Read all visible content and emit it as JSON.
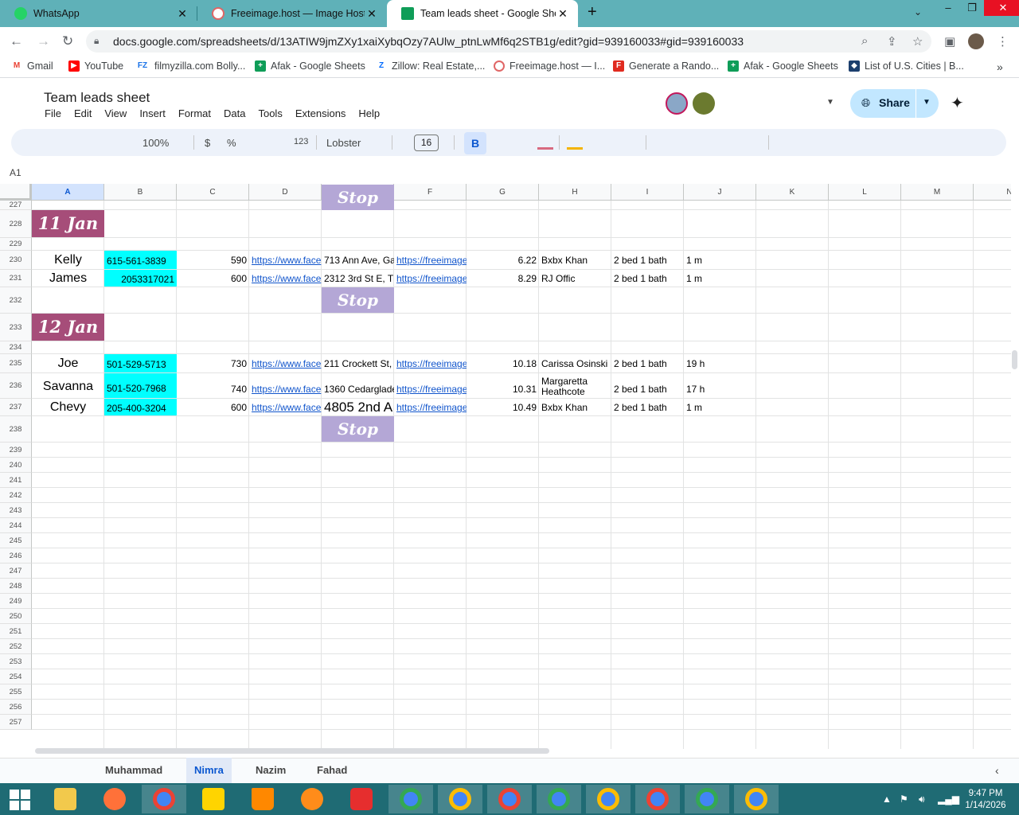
{
  "browser": {
    "tabs": [
      {
        "label": "WhatsApp",
        "icon": "whatsapp-icon",
        "color": "#25d366"
      },
      {
        "label": "Freeimage.host — Image Hosting",
        "icon": "freeimage-icon",
        "color": "#e06666"
      },
      {
        "label": "Team leads sheet - Google Sheets",
        "icon": "sheets-icon",
        "color": "#0f9d58"
      }
    ],
    "url": "docs.google.com/spreadsheets/d/13ATIW9jmZXy1xaiXybqOzy7AUlw_ptnLwMf6q2STB1g/edit?gid=939160033#gid=939160033",
    "bookmarks": [
      {
        "label": "Gmail",
        "icon": "gmail-icon"
      },
      {
        "label": "YouTube",
        "icon": "youtube-icon"
      },
      {
        "label": "filmyzilla.com Bolly...",
        "icon": "fz-icon"
      },
      {
        "label": "Afak - Google Sheets",
        "icon": "sheets-icon"
      },
      {
        "label": "Zillow: Real Estate,...",
        "icon": "zillow-icon"
      },
      {
        "label": "Freeimage.host — I...",
        "icon": "freeimage-icon"
      },
      {
        "label": "Generate a Rando...",
        "icon": "f-icon"
      },
      {
        "label": "Afak - Google Sheets",
        "icon": "sheets-icon"
      },
      {
        "label": "List of U.S. Cities | B...",
        "icon": "cities-icon"
      }
    ]
  },
  "sheet": {
    "title": "Team leads sheet",
    "menu": [
      "File",
      "Edit",
      "View",
      "Insert",
      "Format",
      "Data",
      "Tools",
      "Extensions",
      "Help"
    ],
    "share_label": "Share",
    "toolbar": {
      "zoom": "100%",
      "currency": "$",
      "percent": "%",
      "number_format": "123",
      "font": "Lobster",
      "font_size": "16",
      "bold": "B"
    },
    "name_box": "A1",
    "columns": [
      "A",
      "B",
      "C",
      "D",
      "E",
      "F",
      "G",
      "H",
      "I",
      "J",
      "K",
      "L",
      "M",
      "N"
    ],
    "row_numbers": [
      "227",
      "228",
      "229",
      "230",
      "231",
      "232",
      "233",
      "234",
      "235",
      "236",
      "237",
      "238",
      "239",
      "240",
      "241",
      "242",
      "243",
      "244",
      "245",
      "246",
      "247",
      "248",
      "249",
      "250",
      "251",
      "252",
      "253",
      "254",
      "255",
      "256",
      "257"
    ],
    "dates": [
      "11 Jan",
      "12 Jan"
    ],
    "stop_label": "Stop",
    "rows": [
      {
        "name": "Kelly",
        "phone": "615-561-3839",
        "c": "590",
        "d": "https://www.face",
        "e": "713 Ann Ave, Ga",
        "f": "https://freeimage",
        "g": "6.22",
        "h": "Bxbx Khan",
        "i": "2 bed 1 bath",
        "j": "1 m"
      },
      {
        "name": "James",
        "phone": "2053317021",
        "c": "600",
        "d": "https://www.face",
        "e": "2312 3rd St E, T",
        "f": "https://freeimage",
        "g": "8.29",
        "h": "RJ Offic",
        "i": "2 bed 1 bath",
        "j": "1 m"
      },
      {
        "name": "Joe",
        "phone": "501-529-5713",
        "c": "730",
        "d": "https://www.face",
        "e": "211 Crockett St,",
        "f": "https://freeimage",
        "g": "10.18",
        "h": "Carissa Osinski",
        "i": "2 bed 1 bath",
        "j": "19 h"
      },
      {
        "name": "Savanna",
        "phone": "501-520-7968",
        "c": "740",
        "d": "https://www.face",
        "e": "1360 Cedarglade",
        "f": "https://freeimage",
        "g": "10.31",
        "h1": "Margaretta",
        "h2": "Heathcote",
        "i": "2 bed 1 bath",
        "j": "17 h"
      },
      {
        "name": "Chevy",
        "phone": "205-400-3204",
        "c": "600",
        "d": "https://www.face",
        "e": "4805 2nd A",
        "f": "https://freeimage",
        "g": "10.49",
        "h": "Bxbx Khan",
        "i": "2 bed 1 bath",
        "j": "1 m"
      }
    ],
    "sheet_tabs": [
      "Muhammad",
      "Nimra",
      "Nazim",
      "Fahad"
    ],
    "active_tab": "Nimra"
  },
  "taskbar": {
    "time": "9:47 PM",
    "date": "1/14/2026"
  },
  "colors": {
    "date_banner": "#a64d79",
    "stop_banner": "#b4a7d6",
    "phone_fill": "#00ffff",
    "link": "#1155cc",
    "tabstrip": "#5fb1b8",
    "taskbar": "#1f6b74"
  }
}
